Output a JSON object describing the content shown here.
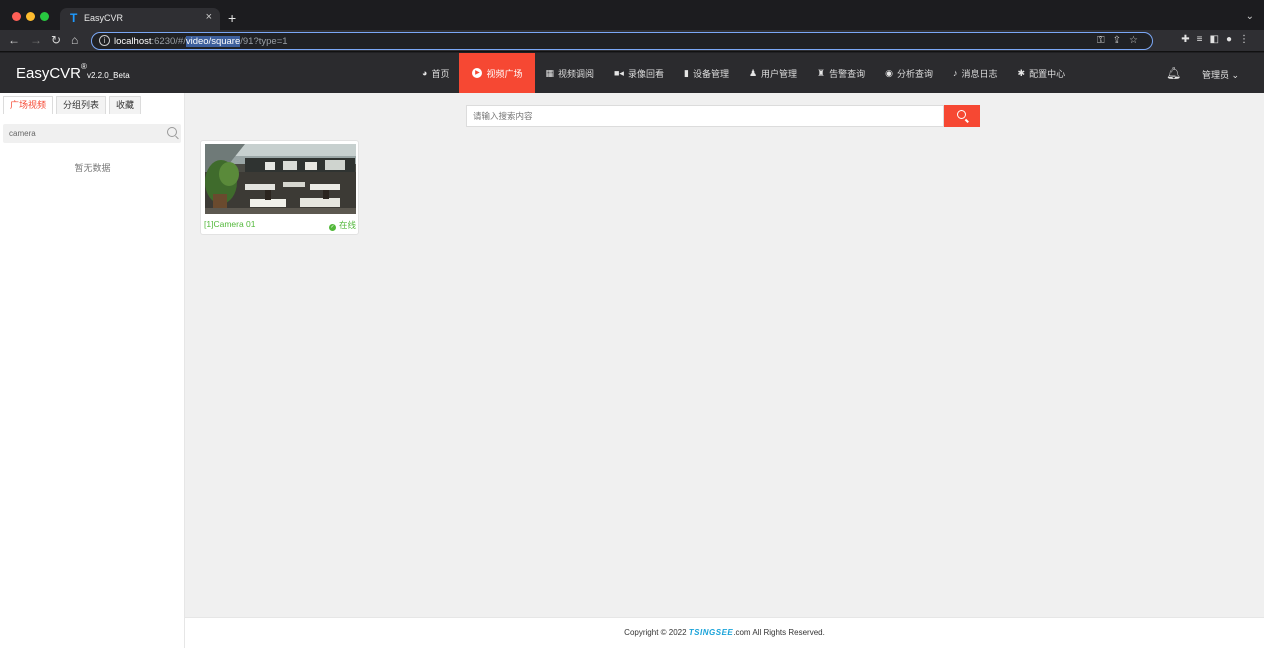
{
  "browser": {
    "tab_title": "EasyCVR",
    "tab_favicon": "T",
    "tab_close": "×",
    "new_tab": "+",
    "url_host": "localhost",
    "url_port_path": ":6230/#/",
    "url_selected": "video/square",
    "url_rest": "/91?type=1"
  },
  "app": {
    "logo": "EasyCVR",
    "logo_reg": "®",
    "version": "v2.2.0_Beta",
    "nav": [
      {
        "label": "首页",
        "icon": "dashboard-icon"
      },
      {
        "label": "视频广场",
        "icon": "play-circle-icon"
      },
      {
        "label": "视频调阅",
        "icon": "grid-icon"
      },
      {
        "label": "录像回看",
        "icon": "video-camera-icon"
      },
      {
        "label": "设备管理",
        "icon": "device-icon"
      },
      {
        "label": "用户管理",
        "icon": "user-icon"
      },
      {
        "label": "告警查询",
        "icon": "alarm-icon"
      },
      {
        "label": "分析查询",
        "icon": "analysis-icon"
      },
      {
        "label": "消息日志",
        "icon": "bell-icon"
      },
      {
        "label": "配置中心",
        "icon": "gear-icon"
      }
    ],
    "admin_label": "管理员"
  },
  "sidebar": {
    "tabs": [
      "广场视频",
      "分组列表",
      "收藏"
    ],
    "search_value": "camera",
    "empty_text": "暂无数据"
  },
  "main": {
    "search_placeholder": "请输入搜索内容",
    "cards": [
      {
        "name": "[1]Camera 01",
        "status": "在线"
      }
    ]
  },
  "footer": {
    "prefix": "Copyright © 2022 ",
    "brand": "TSINGSEE",
    "suffix": ".com All Rights Reserved."
  },
  "colors": {
    "accent": "#f64833",
    "online": "#52b83a",
    "header_bg": "#2b2b2e"
  }
}
